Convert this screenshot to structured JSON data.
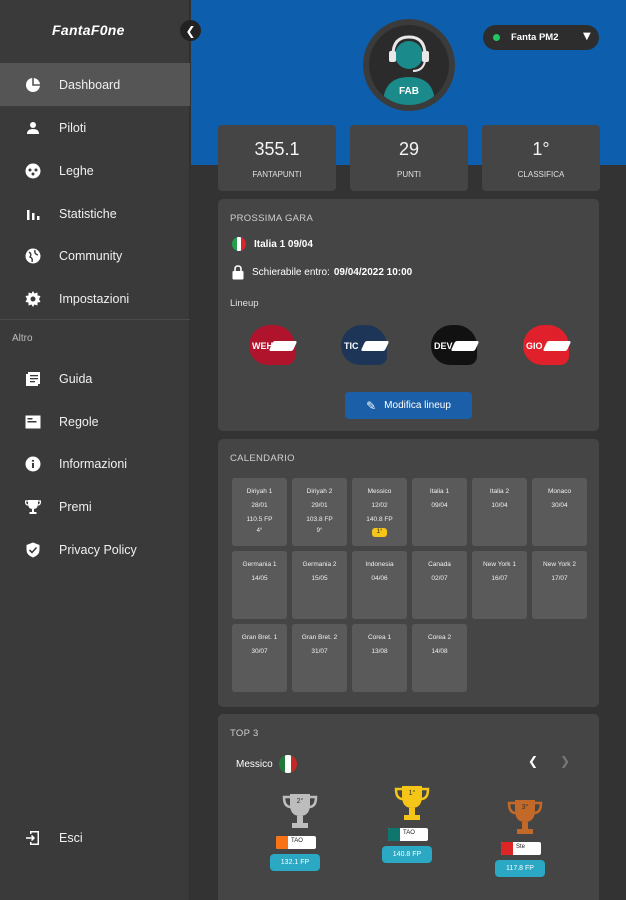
{
  "app": {
    "logo": "FantaF0ne"
  },
  "sidebar": {
    "items": [
      {
        "label": "Dashboard",
        "icon": "pie-chart-icon"
      },
      {
        "label": "Piloti",
        "icon": "person-icon"
      },
      {
        "label": "Leghe",
        "icon": "group-icon"
      },
      {
        "label": "Statistiche",
        "icon": "bar-chart-icon"
      },
      {
        "label": "Community",
        "icon": "globe-icon"
      },
      {
        "label": "Impostazioni",
        "icon": "gear-icon"
      }
    ],
    "section_label": "Altro",
    "other_items": [
      {
        "label": "Guida",
        "icon": "book-icon"
      },
      {
        "label": "Regole",
        "icon": "rules-icon"
      },
      {
        "label": "Informazioni",
        "icon": "info-icon"
      },
      {
        "label": "Premi",
        "icon": "trophy-icon"
      },
      {
        "label": "Privacy Policy",
        "icon": "shield-check-icon"
      }
    ],
    "logout_label": "Esci"
  },
  "user": {
    "name": "FAB"
  },
  "team_selector": {
    "selected": "Fanta PM2",
    "status_color": "#22c55e"
  },
  "stats": [
    {
      "value": "355.1",
      "label": "FANTAPUNTI"
    },
    {
      "value": "29",
      "label": "PUNTI"
    },
    {
      "value": "1°",
      "label": "CLASSIFICA"
    }
  ],
  "next_race": {
    "title": "PROSSIMA GARA",
    "race": "Italia 1 09/04",
    "deadline_prefix": "Schierabile entro:",
    "deadline": "09/04/2022 10:00",
    "lineup_label": "Lineup",
    "drivers": [
      {
        "code": "WEH",
        "color": "#b0142d"
      },
      {
        "code": "TIC",
        "color": "#1d3557"
      },
      {
        "code": "DEV",
        "color": "#111111"
      },
      {
        "code": "GIO",
        "color": "#e0202a"
      }
    ],
    "edit_button": "Modifica lineup"
  },
  "calendar": {
    "title": "CALENDARIO",
    "races": [
      {
        "name": "Diriyah 1",
        "date": "28/01",
        "fp": "110.5 FP",
        "pos": "4°"
      },
      {
        "name": "Diriyah 2",
        "date": "29/01",
        "fp": "103.8 FP",
        "pos": "9°"
      },
      {
        "name": "Messico",
        "date": "12/02",
        "fp": "140.8 FP",
        "pos": "1°",
        "badge": true
      },
      {
        "name": "Italia 1",
        "date": "09/04"
      },
      {
        "name": "Italia 2",
        "date": "10/04"
      },
      {
        "name": "Monaco",
        "date": "30/04"
      },
      {
        "name": "Germania 1",
        "date": "14/05"
      },
      {
        "name": "Germania 2",
        "date": "15/05"
      },
      {
        "name": "Indonesia",
        "date": "04/06"
      },
      {
        "name": "Canada",
        "date": "02/07"
      },
      {
        "name": "New York 1",
        "date": "16/07"
      },
      {
        "name": "New York 2",
        "date": "17/07"
      },
      {
        "name": "Gran Bret. 1",
        "date": "30/07"
      },
      {
        "name": "Gran Bret. 2",
        "date": "31/07"
      },
      {
        "name": "Corea 1",
        "date": "13/08"
      },
      {
        "name": "Corea 2",
        "date": "14/08"
      }
    ]
  },
  "top3": {
    "title": "TOP 3",
    "race": "Messico",
    "podium": [
      {
        "place": "2°",
        "code": "TAO",
        "fp": "132.1 FP",
        "trophy_color": "#bdbdbd",
        "tag_color": "#f97316"
      },
      {
        "place": "1°",
        "code": "TAO",
        "fp": "140.8 FP",
        "trophy_color": "#f5c518",
        "tag_color": "#0f766e"
      },
      {
        "place": "3°",
        "code": "Ste",
        "fp": "117.8 FP",
        "trophy_color": "#c2692a",
        "tag_color": "#dc2626"
      }
    ]
  },
  "colors": {
    "accent": "#0d5fad",
    "fp_pill": "#2aa8c4"
  }
}
